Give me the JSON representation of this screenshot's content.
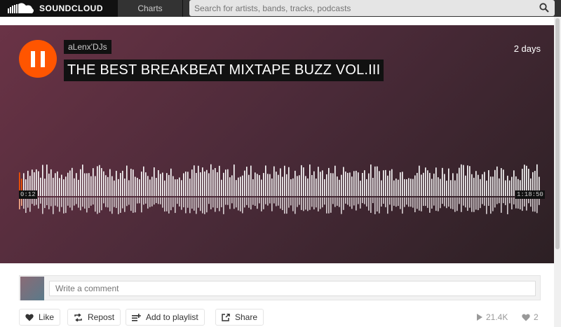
{
  "header": {
    "brand": "SOUNDCLOUD",
    "nav_charts": "Charts",
    "search_placeholder": "Search for artists, bands, tracks, podcasts"
  },
  "track": {
    "artist": "aLenx'DJs",
    "title": "THE BEST BREAKBEAT MIXTAPE BUZZ VOL.III",
    "posted": "2 days",
    "time_current": "0:12",
    "time_total": "1:18:50",
    "played_fraction": 0.0025,
    "state": "playing"
  },
  "comment": {
    "placeholder": "Write a comment"
  },
  "actions": {
    "like": "Like",
    "repost": "Repost",
    "add_to_playlist": "Add to playlist",
    "share": "Share"
  },
  "stats": {
    "plays": "21.4K",
    "likes": "2"
  },
  "colors": {
    "accent": "#ff5500",
    "header_bg": "#333333"
  }
}
